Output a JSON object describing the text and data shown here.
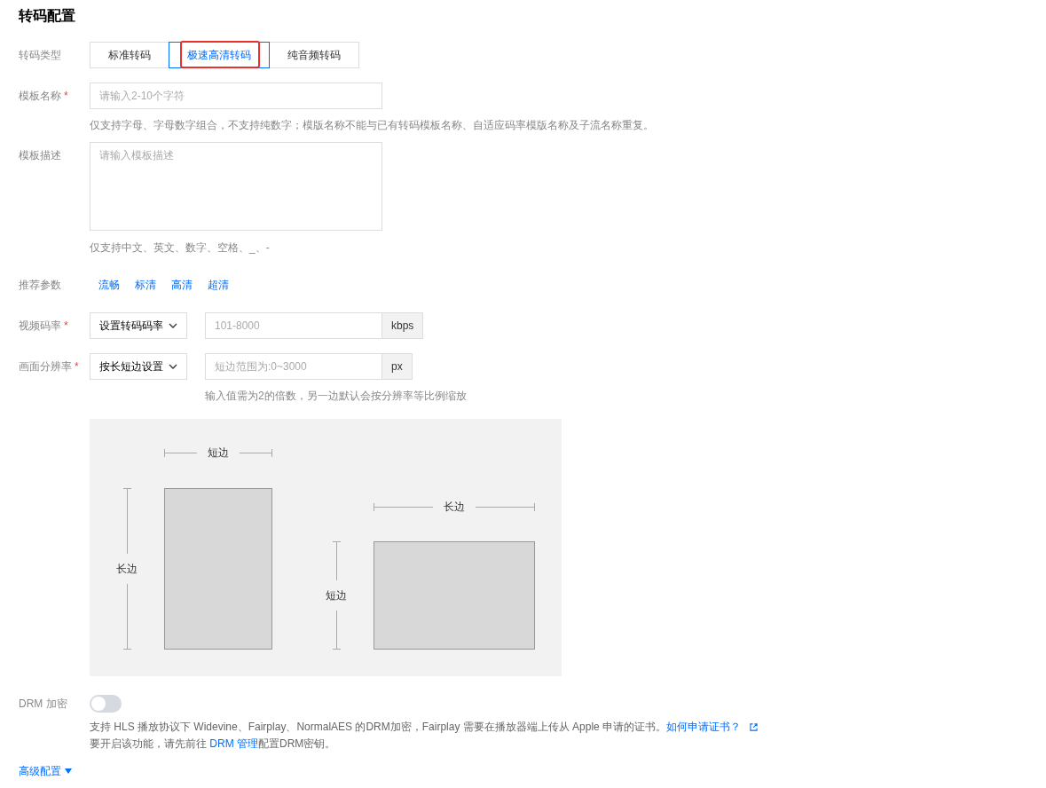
{
  "title": "转码配置",
  "type_row": {
    "label": "转码类型",
    "options": [
      {
        "label": "标准转码",
        "selected": false,
        "highlighted": false
      },
      {
        "label": "极速高清转码",
        "selected": true,
        "highlighted": true
      },
      {
        "label": "纯音频转码",
        "selected": false,
        "highlighted": false
      }
    ]
  },
  "name_row": {
    "label": "模板名称",
    "required_mark": "*",
    "placeholder": "请输入2-10个字符",
    "hint": "仅支持字母、字母数字组合，不支持纯数字；模版名称不能与已有转码模板名称、自适应码率模版名称及子流名称重复。"
  },
  "desc_row": {
    "label": "模板描述",
    "placeholder": "请输入模板描述",
    "hint": "仅支持中文、英文、数字、空格、_、-"
  },
  "preset_row": {
    "label": "推荐参数",
    "presets": [
      "流畅",
      "标清",
      "高清",
      "超清"
    ]
  },
  "bitrate_row": {
    "label": "视频码率",
    "required_mark": "*",
    "select": "设置转码码率",
    "placeholder": "101-8000",
    "unit": "kbps"
  },
  "resolution_row": {
    "label": "画面分辨率",
    "required_mark": "*",
    "select": "按长短边设置",
    "placeholder": "短边范围为:0~3000",
    "unit": "px",
    "hint": "输入值需为2的倍数，另一边默认会按分辨率等比例缩放"
  },
  "diagram": {
    "portrait_width": "短边",
    "portrait_height": "长边",
    "landscape_width": "长边",
    "landscape_height": "短边"
  },
  "drm": {
    "label": "DRM 加密",
    "on": false,
    "line1": "支持 HLS 播放协议下 Widevine、Fairplay、NormalAES 的DRM加密，Fairplay 需要在播放器端上传从 Apple 申请的证书。",
    "line1_link": "如何申请证书？",
    "line2_before": "要开启该功能，请先前往 ",
    "line2_link": "DRM 管理",
    "line2_after": "配置DRM密钥。"
  },
  "advanced": {
    "label": "高级配置",
    "expanded": false
  }
}
